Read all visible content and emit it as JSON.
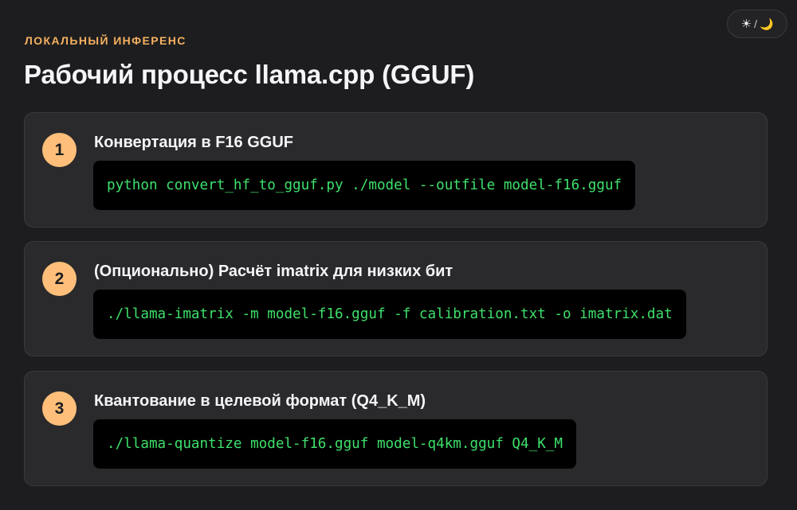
{
  "theme_toggle": {
    "sun_icon": "☀",
    "separator": "/",
    "moon_icon": "🌙"
  },
  "header": {
    "eyebrow": "ЛОКАЛЬНЫЙ ИНФЕРЕНС",
    "title": "Рабочий процесс llama.cpp (GGUF)"
  },
  "steps": [
    {
      "number": "1",
      "title": "Конвертация в F16 GGUF",
      "command": "python convert_hf_to_gguf.py ./model --outfile model-f16.gguf"
    },
    {
      "number": "2",
      "title": "(Опционально) Расчёт imatrix для низких бит",
      "command": "./llama-imatrix -m model-f16.gguf -f calibration.txt -o imatrix.dat"
    },
    {
      "number": "3",
      "title": "Квантование в целевой формат (Q4_K_M)",
      "command": "./llama-quantize model-f16.gguf model-q4km.gguf Q4_K_M"
    }
  ],
  "colors": {
    "background": "#1d1d1f",
    "card": "#2a2a2c",
    "accent": "#f5b060",
    "step_badge": "#ffbf7a",
    "code_text": "#3ee06b"
  }
}
